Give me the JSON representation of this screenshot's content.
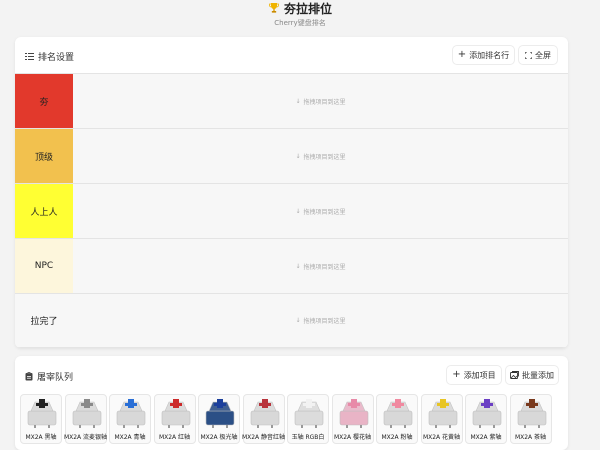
{
  "header": {
    "title": "夯拉排位",
    "subtitle": "Cherry键盘排名"
  },
  "tier_panel": {
    "label": "排名设置",
    "add_row_label": "添加排名行",
    "fullscreen_label": "全屏",
    "drop_hint": "拖拽项目到这里",
    "tiers": [
      {
        "label": "夯",
        "color": "#e2392c"
      },
      {
        "label": "顶级",
        "color": "#f2c14e"
      },
      {
        "label": "人上人",
        "color": "#ffff33"
      },
      {
        "label": "NPC",
        "color": "#fdf6dc"
      },
      {
        "label": "拉完了",
        "color": "#f7f7f7"
      }
    ]
  },
  "queue": {
    "label": "屠宰队列",
    "add_item_label": "添加项目",
    "batch_add_label": "批量添加",
    "items": [
      {
        "name": "MX2A 黑轴",
        "stem_color": "#222222",
        "housing": "#d8d8d8"
      },
      {
        "name": "MX2A 流麦银轴",
        "stem_color": "#8a8a8a",
        "housing": "#d8d8d8"
      },
      {
        "name": "MX2A 青轴",
        "stem_color": "#2a6fd6",
        "housing": "#d8d8d8"
      },
      {
        "name": "MX2A 红轴",
        "stem_color": "#cc2a2a",
        "housing": "#d8d8d8"
      },
      {
        "name": "MX2A 极光轴",
        "stem_color": "#1b3f9c",
        "housing": "#2b4f86"
      },
      {
        "name": "MX2A 静音红轴",
        "stem_color": "#b8333b",
        "housing": "#d8d8d8"
      },
      {
        "name": "玉轴 RGB白",
        "stem_color": "#f2f2f2",
        "housing": "#dcdcdc"
      },
      {
        "name": "MX2A 樱花轴",
        "stem_color": "#e88aa8",
        "housing": "#e9b4c6"
      },
      {
        "name": "MX2A 粉轴",
        "stem_color": "#f08aa0",
        "housing": "#d8d8d8"
      },
      {
        "name": "MX2A 花黄轴",
        "stem_color": "#e8c524",
        "housing": "#d8d8d8"
      },
      {
        "name": "MX2A 紫轴",
        "stem_color": "#6b3fc4",
        "housing": "#d8d8d8"
      },
      {
        "name": "MX2A 茶轴",
        "stem_color": "#7a3a1e",
        "housing": "#d8d8d8"
      }
    ]
  }
}
